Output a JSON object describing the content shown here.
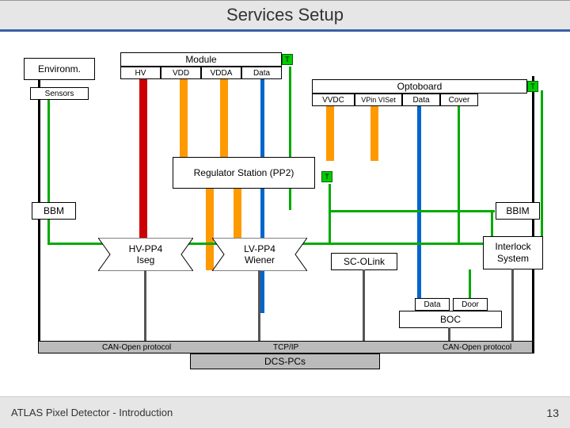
{
  "title": "Services Setup",
  "footer_left": "ATLAS Pixel Detector - Introduction",
  "footer_page": "13",
  "boxes": {
    "environm": "Environm.",
    "sensors": "Sensors",
    "module": "Module",
    "optoboard": "Optoboard",
    "module_hv": "HV",
    "module_vdd": "VDD",
    "module_vdda": "VDDA",
    "module_data": "Data",
    "module_t": "T",
    "opto_vvdc": "VVDC",
    "opto_vpin": "VPin VISet",
    "opto_data": "Data",
    "opto_cover": "Cover",
    "opto_t": "T",
    "regulator": "Regulator Station (PP2)",
    "reg_t": "T",
    "bbm": "BBM",
    "bbim": "BBIM",
    "hvpp4": "HV-PP4",
    "iseg": "Iseg",
    "lvpp4": "LV-PP4",
    "wiener": "Wiener",
    "scolink": "SC-OLink",
    "interlock1": "Interlock",
    "interlock2": "System",
    "boc": "BOC",
    "boc_data": "Data",
    "boc_door": "Door",
    "canopen": "CAN-Open protocol",
    "tcpip": "TCP/IP",
    "dcspcs": "DCS-PCs"
  }
}
